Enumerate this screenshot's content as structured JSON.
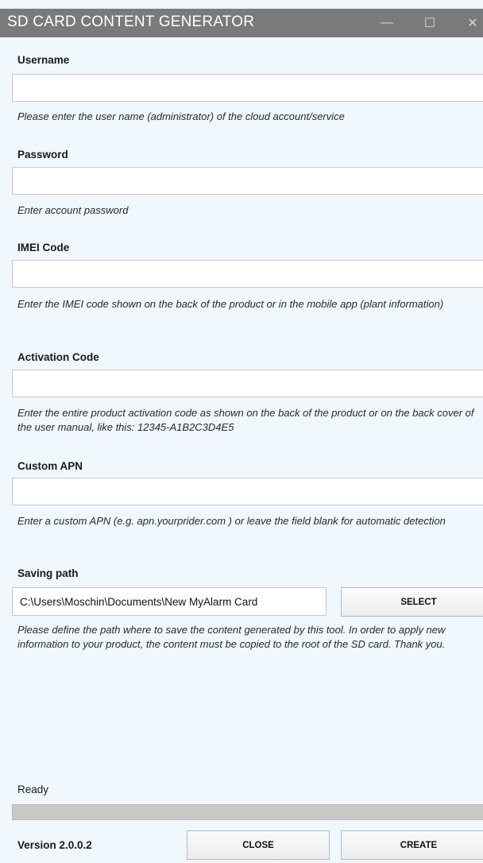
{
  "window": {
    "title": "SD CARD CONTENT GENERATOR",
    "controls": {
      "minimize": "—",
      "maximize": "☐",
      "close": "✕"
    }
  },
  "fields": {
    "username": {
      "label": "Username",
      "value": "",
      "hint": "Please enter the user name (administrator) of the cloud account/service"
    },
    "password": {
      "label": "Password",
      "value": "",
      "hint": "Enter account password"
    },
    "imei": {
      "label": "IMEI Code",
      "value": "",
      "hint": "Enter the IMEI code shown on the back of the product or in the mobile app (plant information)"
    },
    "activation": {
      "label": "Activation Code",
      "value": "",
      "hint": "Enter the entire product activation code as shown on the back of the product or on the back cover of the user manual, like this: 12345-A1B2C3D4E5"
    },
    "apn": {
      "label": "Custom APN",
      "value": "",
      "hint": "Enter a custom APN (e.g. apn.yourprider.com ) or leave the field blank for automatic detection"
    },
    "saving_path": {
      "label": "Saving path",
      "value": "C:\\Users\\Moschin\\Documents\\New MyAlarm Card",
      "select_label": "SELECT",
      "hint": "Please define the path where to save the content generated by this tool. In order to apply new information to your product, the content must be copied to the root of the SD card. Thank you."
    }
  },
  "status": {
    "text": "Ready",
    "progress": 0
  },
  "footer": {
    "version": "Version 2.0.0.2",
    "close_label": "CLOSE",
    "create_label": "CREATE"
  },
  "colors": {
    "background": "#f0f7fd",
    "titlebar": "#7a7a7a",
    "progress_track": "#c8c8c8"
  }
}
